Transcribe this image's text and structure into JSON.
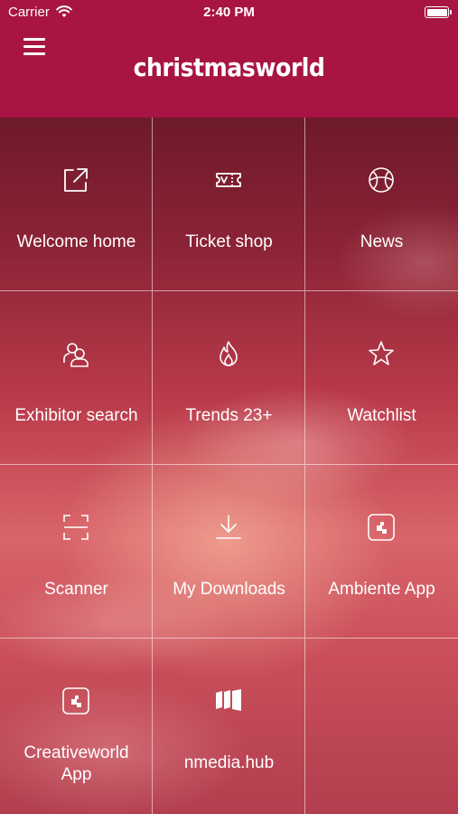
{
  "status": {
    "carrier": "Carrier",
    "time": "2:40 PM"
  },
  "header": {
    "title": "christmasworld",
    "menu_icon": "hamburger-menu-icon"
  },
  "tiles": [
    {
      "label": "Welcome home",
      "icon": "external-link-icon"
    },
    {
      "label": "Ticket shop",
      "icon": "ticket-icon"
    },
    {
      "label": "News",
      "icon": "globe-icon"
    },
    {
      "label": "Exhibitor search",
      "icon": "users-icon"
    },
    {
      "label": "Trends 23+",
      "icon": "flame-icon"
    },
    {
      "label": "Watchlist",
      "icon": "star-icon"
    },
    {
      "label": "Scanner",
      "icon": "scan-frame-icon"
    },
    {
      "label": "My Downloads",
      "icon": "download-icon"
    },
    {
      "label": "Ambiente App",
      "icon": "app-tile-icon"
    },
    {
      "label": "Creativeworld\nApp",
      "icon": "app-tile-icon"
    },
    {
      "label": "nmedia.hub",
      "icon": "nmedia-logo-icon"
    }
  ]
}
